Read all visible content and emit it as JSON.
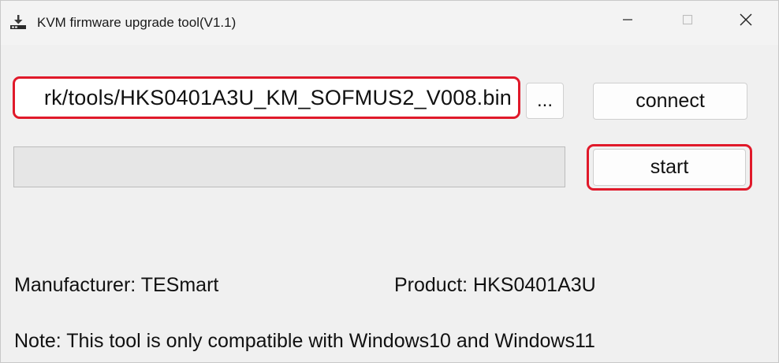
{
  "window": {
    "title": "KVM firmware upgrade tool(V1.1)",
    "app_icon": "kvm-tool-icon",
    "controls": {
      "minimize_icon": "minimize-icon",
      "maximize_icon": "maximize-icon",
      "close_icon": "close-icon"
    }
  },
  "file": {
    "path_value": "rk/tools/HKS0401A3U_KM_SOFMUS2_V008.bin",
    "browse_label": "..."
  },
  "buttons": {
    "connect_label": "connect",
    "start_label": "start"
  },
  "progress": {
    "value": 0
  },
  "info": {
    "manufacturer": "Manufacturer: TESmart",
    "product": "Product: HKS0401A3U",
    "note": "Note: This tool is only compatible with Windows10 and Windows11"
  },
  "colors": {
    "highlight": "#e0192a",
    "window_bg": "#f0f0f0",
    "progress_fill": "#06b025"
  }
}
